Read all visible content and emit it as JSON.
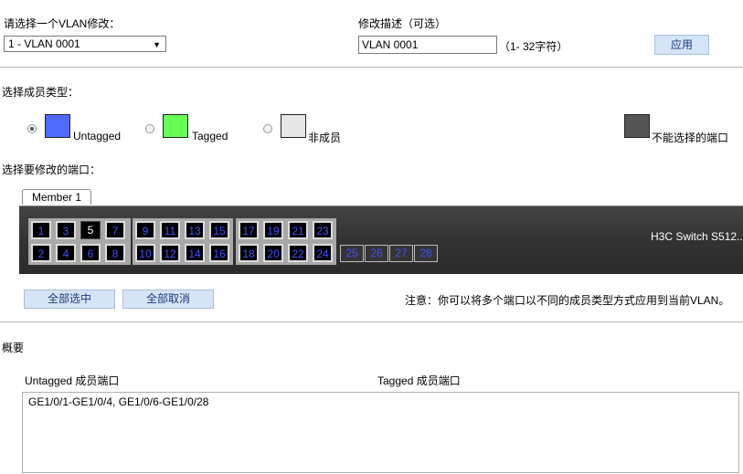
{
  "vlan_select": {
    "label": "请选择一个VLAN修改：",
    "value": "1 - VLAN 0001"
  },
  "description": {
    "label": "修改描述（可选）",
    "value": "VLAN 0001",
    "hint": "（1- 32字符）"
  },
  "apply_label": "应用",
  "member_type": {
    "label": "选择成员类型：",
    "options": [
      {
        "label": "Untagged",
        "color": "#4f6bff",
        "selected": true
      },
      {
        "label": "Tagged",
        "color": "#66ff55",
        "selected": false
      },
      {
        "label": "非成员",
        "color": "#e6e6e6",
        "selected": false
      }
    ],
    "unselectable": {
      "label": "不能选择的端口",
      "color": "#555555"
    }
  },
  "ports_label": "选择要修改的端口：",
  "member_tab": "Member 1",
  "switch_name": "H3C Switch S512...",
  "ports": {
    "top_row": [
      "1",
      "3",
      "5",
      "7",
      "9",
      "11",
      "13",
      "15",
      "17",
      "19",
      "21",
      "23"
    ],
    "bottom_row": [
      "2",
      "4",
      "6",
      "8",
      "10",
      "12",
      "14",
      "16",
      "18",
      "20",
      "22",
      "24"
    ],
    "sfp": [
      "25",
      "26",
      "27",
      "28"
    ],
    "non_member": [
      "5"
    ]
  },
  "select_all_label": "全部选中",
  "deselect_all_label": "全部取消",
  "note": "注意：你可以将多个端口以不同的成员类型方式应用到当前VLAN。",
  "summary": {
    "label": "概要",
    "untagged_header": "Untagged 成员端口",
    "tagged_header": "Tagged 成员端口",
    "untagged_value": "GE1/0/1-GE1/0/4, GE1/0/6-GE1/0/28",
    "tagged_value": ""
  }
}
